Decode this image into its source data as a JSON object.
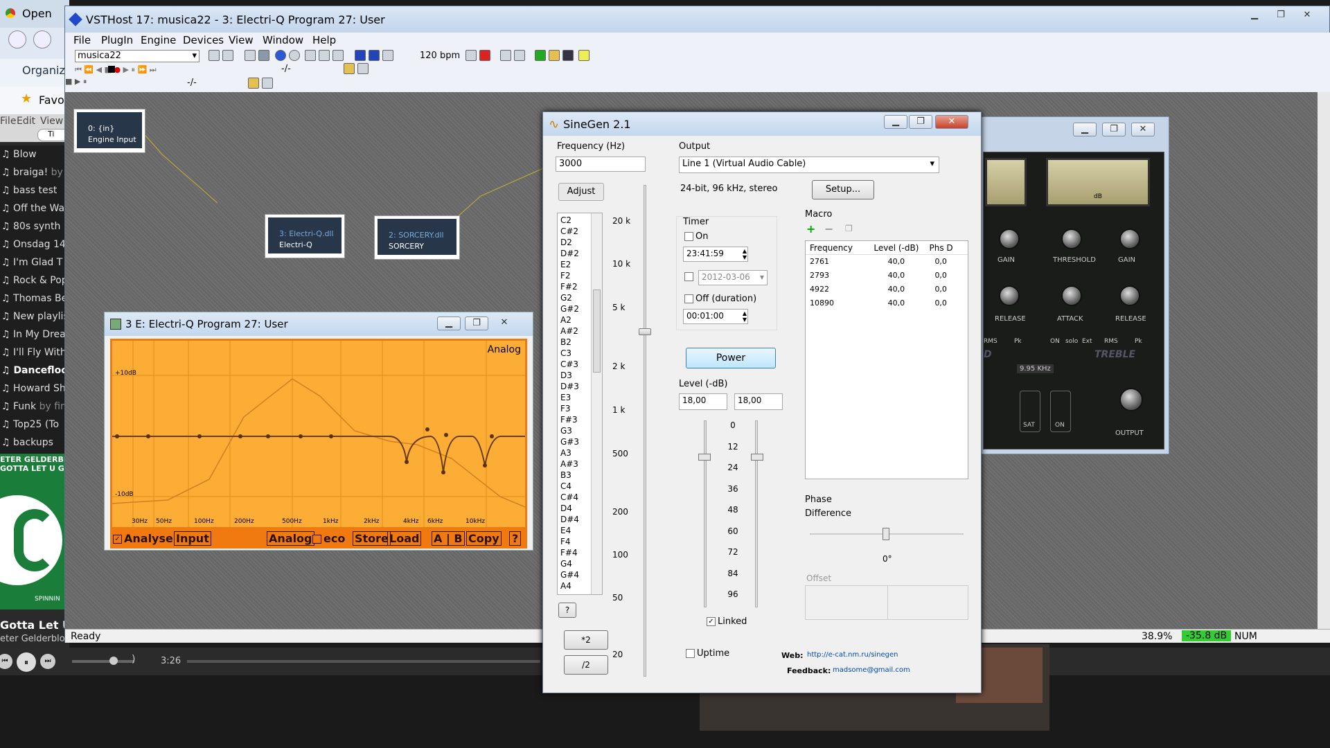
{
  "browser": {
    "tab_open": "Open",
    "organize": "Organize",
    "favorites": "Favo",
    "menu": [
      "File",
      "Edit",
      "View"
    ],
    "search": "Ti"
  },
  "playlist": {
    "items": [
      "Blow",
      "braiga!",
      "bass test",
      "Off the Wa",
      "80s synth",
      "Onsdag 14",
      "I'm Glad T",
      "Rock & Pop",
      "Thomas Be",
      "New playlis",
      "In My Drea",
      "I'll Fly With",
      "Dancefloo",
      "Howard Sh",
      "Funk",
      "Top25 (To",
      "backups"
    ],
    "by_suffix": [
      "by",
      "by fin"
    ],
    "album_caption": "ETER GELDERBE",
    "album_caption2": "GOTTA LET U G",
    "now_playing": "Gotta Let U",
    "artist": "eter Gelderblom",
    "time": "3:26",
    "spinnin": "SPINNIN"
  },
  "vsthost": {
    "title": "VSTHost 17: musica22 - 3: Electri-Q Program 27: User",
    "menu": [
      "File",
      "PlugIn",
      "Engine",
      "Devices",
      "View",
      "Window",
      "Help"
    ],
    "bank": "musica22",
    "bpm": "120 bpm",
    "position": "-/-",
    "position2": "-/-",
    "status": "Ready",
    "cpu": "38.9%",
    "db": "-35.8 dB",
    "num": "NUM",
    "nodes": [
      {
        "line1": "0: {in}",
        "line2": "Engine Input"
      },
      {
        "line1": "3: Electri-Q.dll",
        "line2": "Electri-Q"
      },
      {
        "line1": "2: SORCERY.dll",
        "line2": "SORCERY"
      }
    ]
  },
  "eq": {
    "title": "3 E: Electri-Q Program 27: User",
    "mode": "Analog",
    "db_hi": "+10dB",
    "db_lo": "-10dB",
    "freqs": [
      "30Hz",
      "50Hz",
      "100Hz",
      "200Hz",
      "500Hz",
      "1kHz",
      "2kHz",
      "4kHz",
      "6kHz",
      "10kHz"
    ],
    "buttons": [
      "Analyse",
      "Input",
      "Analog",
      "eco",
      "Store",
      "Load",
      "A | B",
      "Copy",
      "?"
    ]
  },
  "sinegen": {
    "title": "SineGen 2.1",
    "freq_label": "Frequency (Hz)",
    "freq_value": "3000",
    "adjust": "Adjust",
    "notes": [
      "C2",
      "C#2",
      "D2",
      "D#2",
      "E2",
      "F2",
      "F#2",
      "G2",
      "G#2",
      "A2",
      "A#2",
      "B2",
      "C3",
      "C#3",
      "D3",
      "D#3",
      "E3",
      "F3",
      "F#3",
      "G3",
      "G#3",
      "A3",
      "A#3",
      "B3",
      "C4",
      "C#4",
      "D4",
      "D#4",
      "E4",
      "F4",
      "F#4",
      "G4",
      "G#4",
      "A4"
    ],
    "scale": [
      "20 k",
      "10 k",
      "5 k",
      "2 k",
      "1 k",
      "500",
      "200",
      "100",
      "50",
      "20"
    ],
    "q": "?",
    "x2": "*2",
    "d2": "/2",
    "output_label": "Output",
    "output_device": "Line 1 (Virtual Audio Cable)",
    "format": "24-bit, 96 kHz, stereo",
    "setup": "Setup...",
    "timer_label": "Timer",
    "on": "On",
    "time": "23:41:59",
    "date": "2012-03-06",
    "off": "Off (duration)",
    "duration": "00:01:00",
    "power": "Power",
    "level_label": "Level (-dB)",
    "level_l": "18,00",
    "level_r": "18,00",
    "level_scale": [
      "0",
      "12",
      "24",
      "36",
      "48",
      "60",
      "72",
      "84",
      "96"
    ],
    "linked": "Linked",
    "uptime": "Uptime",
    "macro_label": "Macro",
    "macro_cols": [
      "Frequency",
      "Level (-dB)",
      "Phs D"
    ],
    "macro_rows": [
      [
        "2761",
        "40,0",
        "0,0"
      ],
      [
        "2793",
        "40,0",
        "0,0"
      ],
      [
        "4922",
        "40,0",
        "0,0"
      ],
      [
        "10890",
        "40,0",
        "0,0"
      ]
    ],
    "phase_label": "Phase",
    "difference": "Difference",
    "phase_value": "0°",
    "offset": "Offset",
    "web_label": "Web:",
    "web_url": "http://e-cat.nm.ru/sinegen",
    "feedback_label": "Feedback:",
    "feedback_email": "madsome@gmail.com"
  },
  "comp": {
    "labels_top": [
      "GAIN",
      "THRESHOLD",
      "GAIN"
    ],
    "labels_mid": [
      "RELEASE",
      "ATTACK",
      "RELEASE"
    ],
    "rms": "RMS",
    "pk": "Pk",
    "on": "ON",
    "solo": "solo",
    "ext": "Ext",
    "d": "D",
    "treble": "TREBLE",
    "khz": "9.95 KHz",
    "sat": "SAT",
    "on2": "ON",
    "output": "OUTPUT",
    "db": "dB"
  }
}
